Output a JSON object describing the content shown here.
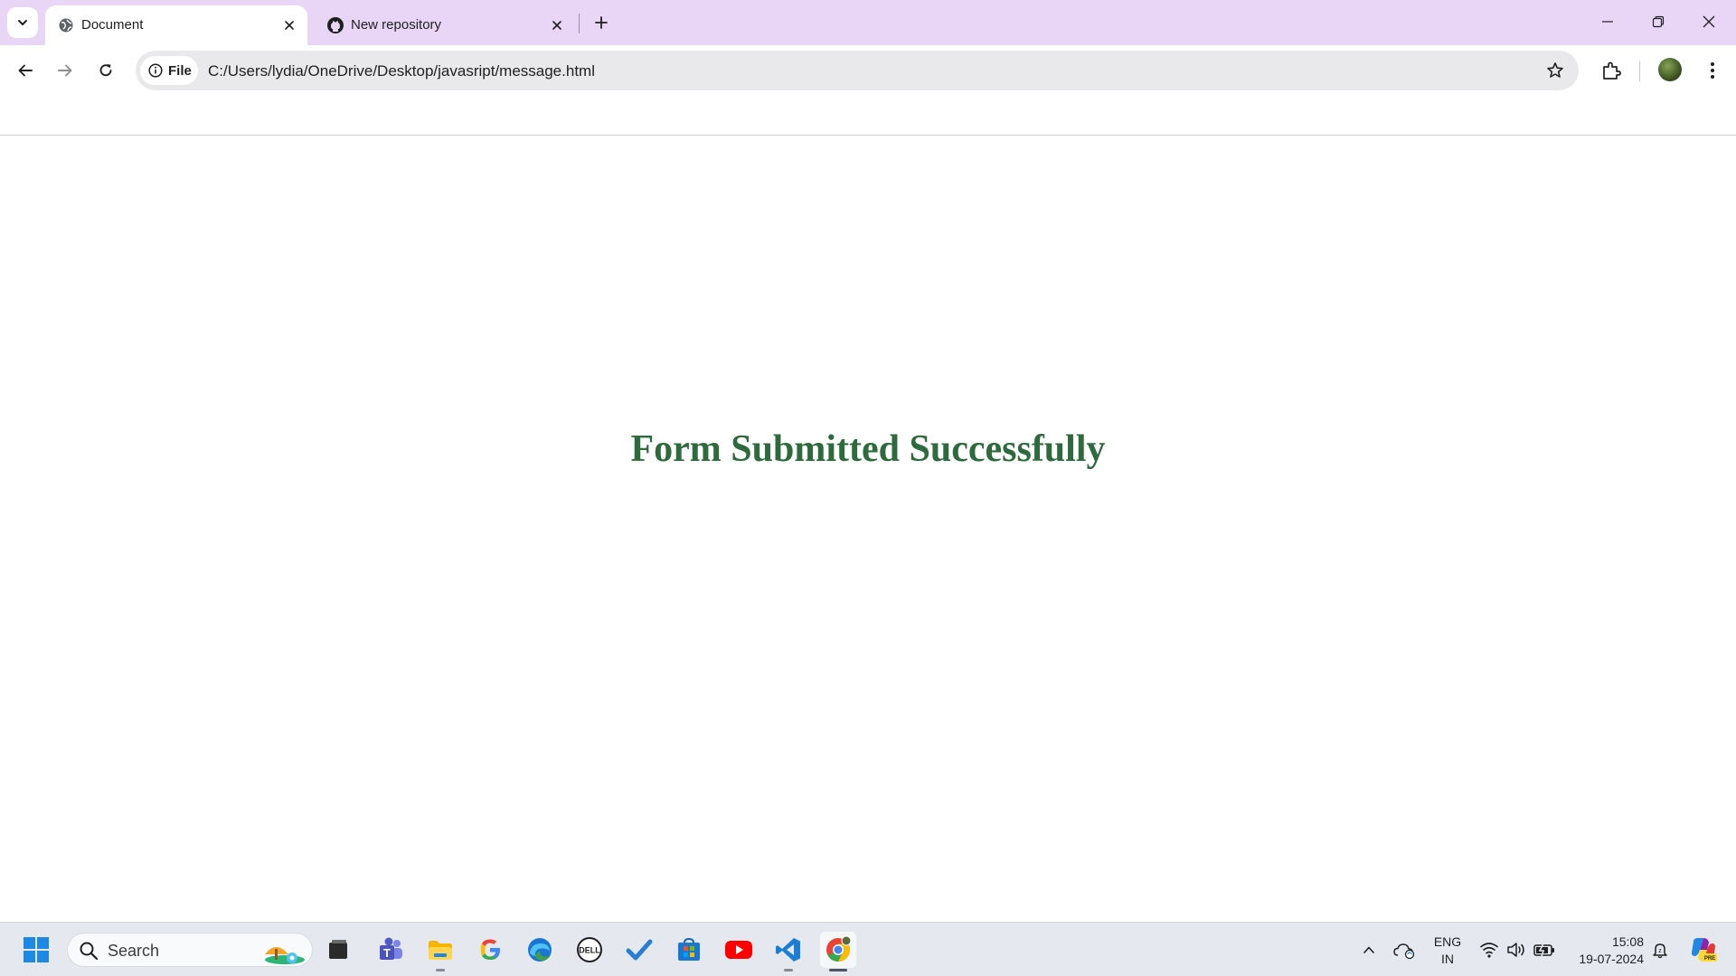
{
  "browser": {
    "tabs": [
      {
        "title": "Document",
        "favicon": "globe-icon",
        "active": true
      },
      {
        "title": "New repository",
        "favicon": "github-icon",
        "active": false
      }
    ],
    "address": {
      "chip_label": "File",
      "url": "C:/Users/lydia/OneDrive/Desktop/javasript/message.html"
    },
    "colors": {
      "frame": "#e9d6f7",
      "toolbar": "#ffffff",
      "omnibox": "#e9e9ec"
    }
  },
  "page": {
    "message": "Form Submitted Successfully",
    "message_color": "#2e6b3c"
  },
  "taskbar": {
    "search_label": "Search",
    "apps": [
      "windows-start-icon",
      "search-icon",
      "file-manager-icon",
      "teams-icon",
      "file-explorer-icon",
      "google-icon",
      "edge-icon",
      "dell-icon",
      "todo-icon",
      "store-icon",
      "youtube-icon",
      "vscode-icon",
      "chrome-icon"
    ],
    "tray": {
      "lang_line1": "ENG",
      "lang_line2": "IN",
      "time": "15:08",
      "date": "19-07-2024"
    }
  }
}
